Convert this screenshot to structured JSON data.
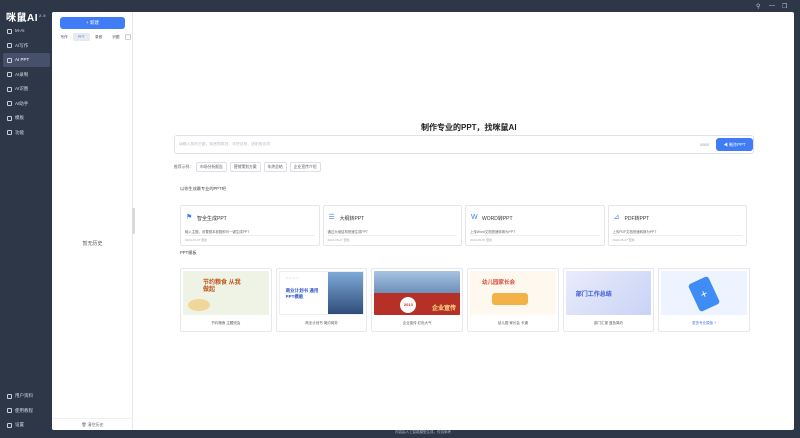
{
  "app": {
    "logo": "咪鼠AI",
    "version": "2.0"
  },
  "nav": {
    "items": [
      {
        "label": "M-AI",
        "icon": "ai-icon"
      },
      {
        "label": "AI写作",
        "icon": "pen-icon"
      },
      {
        "label": "AI PPT",
        "icon": "ppt-icon"
      },
      {
        "label": "AI录制",
        "icon": "record-icon"
      },
      {
        "label": "AI识图",
        "icon": "image-icon"
      },
      {
        "label": "AI助手",
        "icon": "assistant-icon"
      },
      {
        "label": "模板",
        "icon": "template-icon"
      },
      {
        "label": "功能",
        "icon": "feature-icon"
      }
    ],
    "active_index": 2,
    "bottom": [
      {
        "label": "用户资料",
        "icon": "user-icon"
      },
      {
        "label": "使用教程",
        "icon": "help-icon"
      },
      {
        "label": "设置",
        "icon": "gear-icon"
      }
    ]
  },
  "history": {
    "new_button": "+ 新建",
    "tabs": [
      "写作",
      "PPT",
      "录音",
      "识图"
    ],
    "active_tab": 1,
    "empty_text": "暂无历史",
    "footer": "清空历史"
  },
  "main": {
    "headline": "制作专业的PPT，找咪鼠AI",
    "search": {
      "placeholder": "请输入您的主题，如营销策划、年终总结、述职报告等",
      "count": "0/500"
    },
    "make_button": "◀ 制作PPT",
    "examples_label": "推荐示例：",
    "examples": [
      "市场分析报告",
      "营销策划方案",
      "年终总结",
      "企业宣传介绍"
    ],
    "modes_title": "以你生成最专业的PPT吧",
    "modes": [
      {
        "title": "智全生成PPT",
        "desc": "输入主题，设置基本参数即可一键生成PPT",
        "date": "2024-05-07 更新",
        "icon": "flag-icon"
      },
      {
        "title": "大纲转PPT",
        "desc": "通过大纲结构快速生成PPT",
        "date": "2024-05-07 更新",
        "icon": "list-icon"
      },
      {
        "title": "WORD转PPT",
        "desc": "上传Word文档快速转换为PPT",
        "date": "2024-05-07 更新",
        "icon": "word-icon"
      },
      {
        "title": "PDF转PPT",
        "desc": "上传PDF文档快速转换为PPT",
        "date": "2024-05-07 更新",
        "icon": "pdf-icon"
      }
    ],
    "templates_title": "PPT模板",
    "templates": [
      {
        "caption": "节约粮食 主题班会",
        "thumb_text": "节约粮食 从我做起"
      },
      {
        "caption": "商业计划书 简约商务",
        "thumb_text": "商业计划书 通用PPT模板"
      },
      {
        "caption": "企业宣传 红色大气",
        "thumb_text": "企业宣传"
      },
      {
        "caption": "幼儿园 家长会 卡通",
        "thumb_text": "幼儿园家长会"
      },
      {
        "caption": "部门汇报 蓝色简约",
        "thumb_text": "部门工作总结"
      },
      {
        "caption": "更多专业模板 +",
        "thumb_text": ""
      }
    ]
  },
  "footer": "内容由人工智能模型生成，仅供参考"
}
